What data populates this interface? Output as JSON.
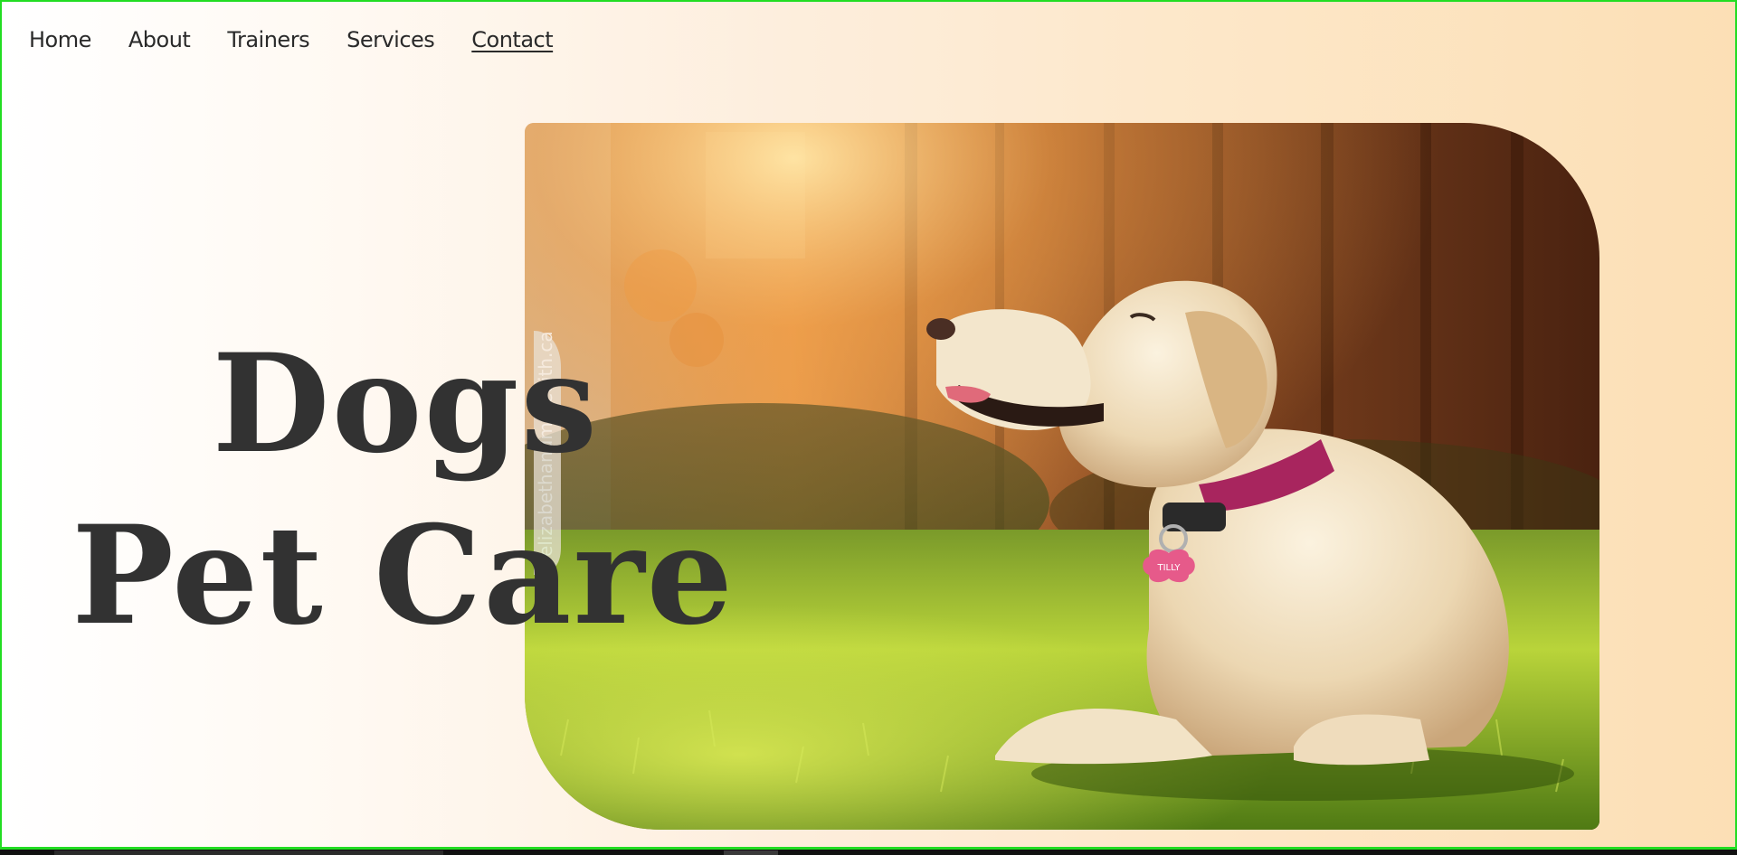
{
  "nav": {
    "items": [
      {
        "label": "Home",
        "active": false
      },
      {
        "label": "About",
        "active": false
      },
      {
        "label": "Trainers",
        "active": false
      },
      {
        "label": "Services",
        "active": false
      },
      {
        "label": "Contact",
        "active": true
      }
    ]
  },
  "hero": {
    "title_line1": "Dogs",
    "title_line2": "Pet Care",
    "photo_watermark": "elizabethandmeredith.ca",
    "photo_tag_text": "TILLY"
  },
  "colors": {
    "page_border": "#22dd22",
    "title_text": "#323232",
    "nav_text": "#2a2a2a",
    "gradient_start": "#ffffff",
    "gradient_end": "#fcdfb5"
  }
}
